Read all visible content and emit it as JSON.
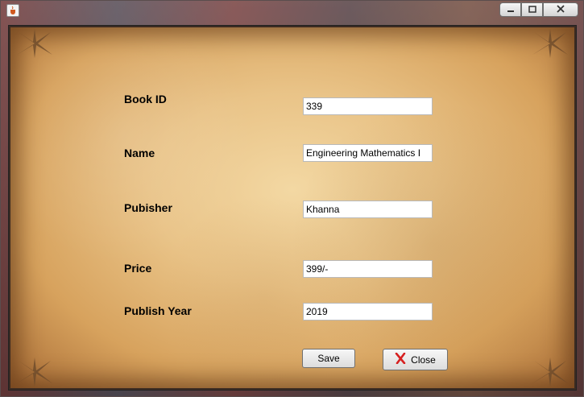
{
  "window": {
    "app_icon": "java-cup-icon",
    "controls": {
      "minimize_icon": "minimize-icon",
      "maximize_icon": "maximize-icon",
      "close_icon": "close-icon"
    }
  },
  "form": {
    "fields": [
      {
        "label": "Book ID",
        "value": "339"
      },
      {
        "label": "Name",
        "value": "Engineering Mathematics I"
      },
      {
        "label": "Pubisher",
        "value": "Khanna"
      },
      {
        "label": "Price",
        "value": "399/-"
      },
      {
        "label": "Publish Year",
        "value": "2019"
      }
    ]
  },
  "buttons": {
    "save_label": "Save",
    "close_label": "Close",
    "close_icon": "red-x-icon"
  },
  "colors": {
    "parchment": "#e9c387",
    "close_x": "#d62020"
  }
}
